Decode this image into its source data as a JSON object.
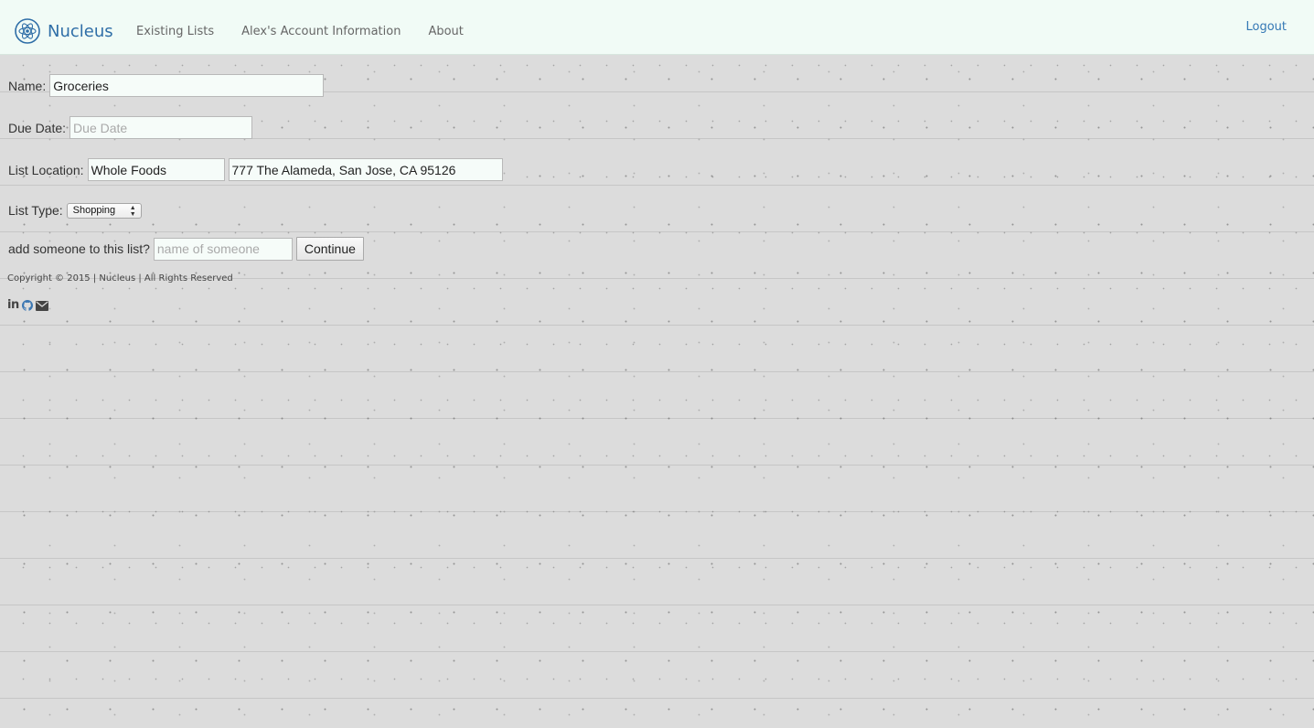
{
  "navbar": {
    "brand_name": "Nucleus",
    "brand_icon": "atom-icon",
    "links": [
      {
        "label": "Existing Lists"
      },
      {
        "label": "Alex's Account Information"
      },
      {
        "label": "About"
      }
    ],
    "logout_label": "Logout"
  },
  "form": {
    "name": {
      "label": "Name:",
      "value": "Groceries",
      "placeholder": ""
    },
    "due_date": {
      "label": "Due Date:",
      "value": "",
      "placeholder": "Due Date"
    },
    "location": {
      "label": "List Location:",
      "place_value": "Whole Foods",
      "address_value": "777 The Alameda, San Jose, CA 95126"
    },
    "list_type": {
      "label": "List Type:",
      "selected": "Shopping"
    },
    "add_person": {
      "label": "add someone to this list?",
      "value": "",
      "placeholder": "name of someone",
      "button_label": "Continue"
    }
  },
  "footer": {
    "copyright": "Copyright © 2015 | Nucleus | All Rights Reserved",
    "social_icons": [
      "linkedin-icon",
      "github-icon",
      "envelope-icon"
    ]
  },
  "colors": {
    "brand": "#2f6ea7",
    "navbar_bg": "#f1fbf6",
    "page_bg": "#dcdcdc",
    "link_accent": "#3478b5"
  }
}
